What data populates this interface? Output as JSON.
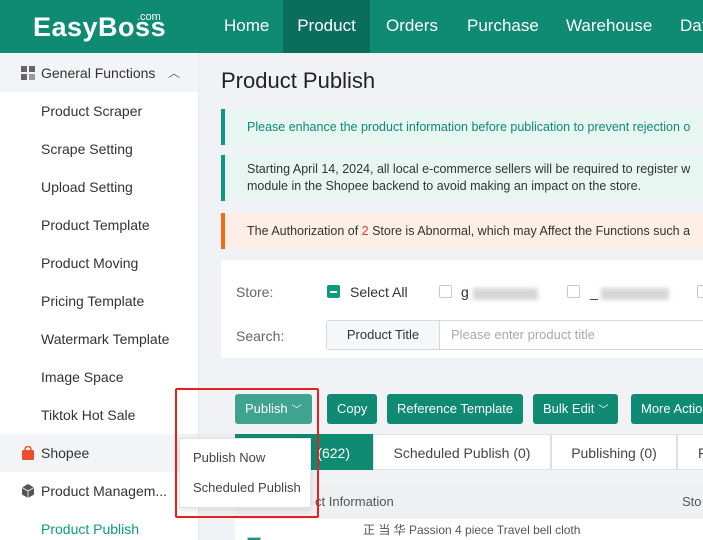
{
  "brand": {
    "logo": "EasyBoss",
    "logo_suffix": ".com"
  },
  "topnav": [
    "Home",
    "Product",
    "Orders",
    "Purchase",
    "Warehouse",
    "Dat"
  ],
  "sidebar": {
    "general_functions": "General Functions",
    "items": [
      "Product Scraper",
      "Scrape Setting",
      "Upload Setting",
      "Product Template",
      "Product Moving",
      "Pricing Template",
      "Watermark Template",
      "Image Space",
      "Tiktok Hot Sale"
    ],
    "shopee": "Shopee",
    "product_management": "Product Managem...",
    "product_publish": "Product Publish"
  },
  "page": {
    "title": "Product Publish",
    "alert1": "Please enhance the product information before publication to prevent rejection o",
    "alert2_line1": "Starting April 14, 2024, all local e-commerce sellers will be required to register w",
    "alert2_line2": "module in the Shopee backend to avoid making an impact on the store.",
    "alert3_pre": "The Authorization of ",
    "alert3_num": "2",
    "alert3_post": " Store is Abnormal, which may Affect the Functions such a"
  },
  "filters": {
    "store_label": "Store:",
    "select_all": "Select All",
    "store_g": "g",
    "store_underscore": "_",
    "search_label": "Search:",
    "search_select": "Product Title",
    "search_placeholder": "Please enter product title"
  },
  "actions": {
    "publish": "Publish",
    "copy": "Copy",
    "reference_template": "Reference Template",
    "bulk_edit": "Bulk Edit",
    "more_actions": "More Actio"
  },
  "tabs": [
    {
      "label": "(622)"
    },
    {
      "label": "Scheduled Publish (0)"
    },
    {
      "label": "Publishing (0)"
    },
    {
      "label": "F"
    }
  ],
  "table": {
    "col_product": "ct Information",
    "col_store": "Sto",
    "row1_text": "正 当 华 Passion 4 piece Travel bell cloth"
  },
  "publish_menu": [
    "Publish Now",
    "Scheduled Publish"
  ],
  "colors": {
    "brand": "#0f8a73",
    "highlight_box": "#e5201d"
  }
}
